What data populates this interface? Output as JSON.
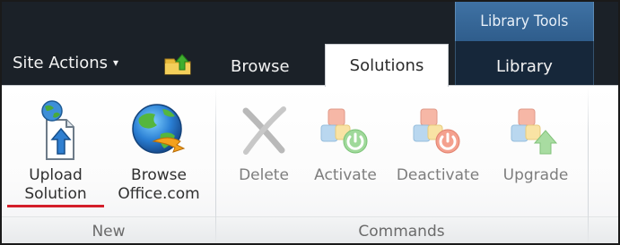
{
  "topbar": {
    "site_actions_label": "Site Actions",
    "site_actions_caret": "▾",
    "contextual_group_label": "Library Tools"
  },
  "tabs": [
    {
      "label": "Browse",
      "selected": false
    },
    {
      "label": "Solutions",
      "selected": true
    },
    {
      "label": "Library",
      "selected": false
    }
  ],
  "groups": {
    "new": {
      "label": "New",
      "buttons": [
        {
          "line1": "Upload",
          "line2": "Solution",
          "icon": "upload-solution-icon",
          "enabled": true
        },
        {
          "line1": "Browse",
          "line2": "Office.com",
          "icon": "globe-icon",
          "enabled": true
        }
      ]
    },
    "commands": {
      "label": "Commands",
      "buttons": [
        {
          "label": "Delete",
          "icon": "delete-x-icon",
          "enabled": false
        },
        {
          "label": "Activate",
          "icon": "activate-icon",
          "enabled": false
        },
        {
          "label": "Deactivate",
          "icon": "deactivate-icon",
          "enabled": false
        },
        {
          "label": "Upgrade",
          "icon": "upgrade-icon",
          "enabled": false
        }
      ]
    }
  },
  "colors": {
    "topbar_bg": "#1b2128",
    "contextual_header": "#2f5d8c",
    "annotation_underline": "#d41f2a"
  }
}
